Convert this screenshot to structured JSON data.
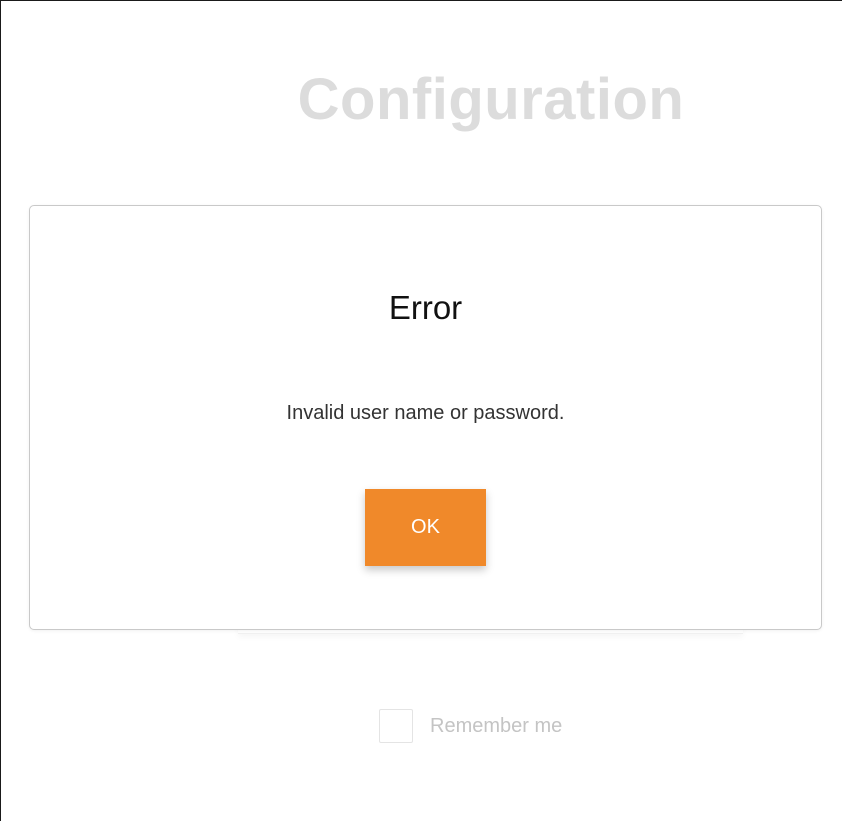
{
  "page": {
    "title": "Configuration"
  },
  "dialog": {
    "title": "Error",
    "message": "Invalid user name or password.",
    "ok_label": "OK"
  },
  "login_form": {
    "remember_me_label": "Remember me",
    "remember_me_checked": false
  },
  "colors": {
    "accent": "#f0892a",
    "title_faded": "#dcdcdc",
    "dialog_border": "#c9c9c9"
  }
}
